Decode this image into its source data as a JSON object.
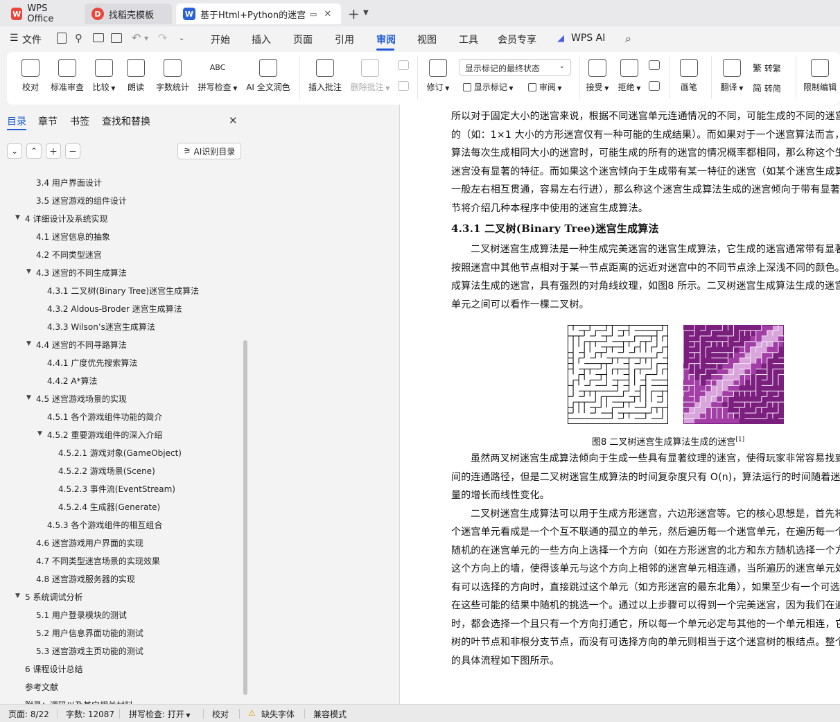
{
  "tabs": [
    {
      "label": "WPS Office",
      "icon": "wps-logo-icon",
      "color": "#e8473c"
    },
    {
      "label": "找稻壳模板",
      "icon": "docer-icon",
      "color": "#e8473c"
    },
    {
      "label": "基于Html+Python的迷宫游戏",
      "icon": "word-doc-icon",
      "color": "#2b62d9"
    }
  ],
  "menu": {
    "file": "文件",
    "items": [
      "开始",
      "插入",
      "页面",
      "引用",
      "审阅",
      "视图",
      "工具",
      "会员专享"
    ],
    "wps_ai": "WPS AI"
  },
  "ribbon": {
    "proofread": "校对",
    "standard_review": "标准审查",
    "compare": "比较",
    "read_aloud": "朗读",
    "word_count": "字数统计",
    "spell_check": "拼写检查",
    "ai_polish": "AI 全文润色",
    "insert_comment": "插入批注",
    "delete_comment": "删除批注",
    "markup_state": "显示标记的最终状态",
    "track_changes": "修订",
    "show_markup": "显示标记",
    "review_pane": "审阅",
    "accept": "接受",
    "reject": "拒绝",
    "ink": "画笔",
    "translate": "翻译",
    "to_traditional": "转繁",
    "to_simplified": "转简",
    "restrict_edit": "限制编辑"
  },
  "left_pane": {
    "tabs": [
      "目录",
      "章节",
      "书签",
      "查找和替换"
    ],
    "ai_toc": "AI识别目录",
    "toc": [
      {
        "label": "3.4  用户界面设计",
        "level": 2,
        "arrow": false
      },
      {
        "label": "3.5  迷宫游戏的组件设计",
        "level": 2,
        "arrow": false
      },
      {
        "label": "4  详细设计及系统实现",
        "level": 1,
        "arrow": true
      },
      {
        "label": "4.1  迷宫信息的抽象",
        "level": 2,
        "arrow": false
      },
      {
        "label": "4.2  不同类型迷宫",
        "level": 2,
        "arrow": false
      },
      {
        "label": "4.3  迷宫的不同生成算法",
        "level": 2,
        "arrow": true
      },
      {
        "label": "4.3.1 二叉树(Binary Tree)迷宫生成算法",
        "level": 3,
        "arrow": false
      },
      {
        "label": "4.3.2 Aldous-Broder 迷宫生成算法",
        "level": 3,
        "arrow": false
      },
      {
        "label": "4.3.3 Wilson’s迷宫生成算法",
        "level": 3,
        "arrow": false
      },
      {
        "label": "4.4  迷宫的不同寻路算法",
        "level": 2,
        "arrow": true
      },
      {
        "label": "4.4.1 广度优先搜索算法",
        "level": 3,
        "arrow": false
      },
      {
        "label": "4.4.2 A*算法",
        "level": 3,
        "arrow": false
      },
      {
        "label": "4.5  迷宫游戏场景的实现",
        "level": 2,
        "arrow": true
      },
      {
        "label": "4.5.1  各个游戏组件功能的简介",
        "level": 3,
        "arrow": false
      },
      {
        "label": "4.5.2  重要游戏组件的深入介绍",
        "level": 3,
        "arrow": true
      },
      {
        "label": "4.5.2.1  游戏对象(GameObject)",
        "level": 4,
        "arrow": false
      },
      {
        "label": "4.5.2.2  游戏场景(Scene)",
        "level": 4,
        "arrow": false
      },
      {
        "label": "4.5.2.3  事件流(EventStream)",
        "level": 4,
        "arrow": false
      },
      {
        "label": "4.5.2.4  生成器(Generate)",
        "level": 4,
        "arrow": false
      },
      {
        "label": "4.5.3  各个游戏组件的相互组合",
        "level": 3,
        "arrow": false
      },
      {
        "label": "4.6  迷宫游戏用户界面的实现",
        "level": 2,
        "arrow": false
      },
      {
        "label": "4.7  不同类型迷宫场景的实现效果",
        "level": 2,
        "arrow": false
      },
      {
        "label": "4.8  迷宫游戏服务器的实现",
        "level": 2,
        "arrow": false
      },
      {
        "label": "5  系统调试分析",
        "level": 1,
        "arrow": true
      },
      {
        "label": "5.1  用户登录模块的测试",
        "level": 2,
        "arrow": false
      },
      {
        "label": "5.2  用户信息界面功能的测试",
        "level": 2,
        "arrow": false
      },
      {
        "label": "5.3  迷宫游戏主页功能的测试",
        "level": 2,
        "arrow": false
      },
      {
        "label": "6  课程设计总结",
        "level": 1,
        "arrow": false
      },
      {
        "label": "参考文献",
        "level": 1,
        "arrow": false
      },
      {
        "label": "附录：源码以及其它相关材料",
        "level": 1,
        "arrow": false
      }
    ]
  },
  "document": {
    "lines_top": [
      "所以对于固定大小的迷宫来说，根据不同迷宫单元连通情况的不同，可能生成的不同的迷宫的",
      "的（如：1×1 大小的方形迷宫仅有一种可能的生成结果）。而如果对于一个迷宫算法而言，若",
      "算法每次生成相同大小的迷宫时，可能生成的所有的迷宫的情况概率都相同，那么称这个生成",
      "迷宫没有显著的特征。而如果这个迷宫倾向于生成带有某一特征的迷宫（如某个迷宫生成算法",
      "一般左右相互贯通，容易左右行进），那么称这个迷宫生成算法生成的迷宫倾向于带有显著的",
      "节将介绍几种本程序中使用的迷宫生成算法。"
    ],
    "heading": "4.3.1 二叉树(Binary Tree)迷宫生成算法",
    "lines_mid": [
      "二叉树迷宫生成算法是一种生成完美迷宫的迷宫生成算法，它生成的迷宫通常带有显著",
      "按照迷宫中其他节点相对于某一节点距离的远近对迷宫中的不同节点涂上深浅不同的颜色。采",
      "成算法生成的迷宫，具有强烈的对角线纹理，如图8 所示。二叉树迷宫生成算法生成的迷宫中",
      "单元之间可以看作一棵二叉树。"
    ],
    "caption": "图8  二叉树迷宫生成算法生成的迷宫",
    "caption_ref": "[1]",
    "lines_bottom": [
      "虽然两叉树迷宫生成算法倾向于生成一些具有显著纹理的迷宫，使得玩家非常容易找到起",
      "间的连通路径，但是二叉树迷宫生成算法的时间复杂度只有 O(n)，算法运行的时间随着迷宫单",
      "量的增长而线性变化。",
      "二叉树迷宫生成算法可以用于生成方形迷宫，六边形迷宫等。它的核心思想是，首先将迷",
      "个迷宫单元看成是一个个互不联通的孤立的单元，然后遍历每一个迷宫单元，在遍历每一个单",
      "随机的在迷宫单元的一些方向上选择一个方向（如在方形迷宫的北方和东方随机选择一个方向",
      "这个方向上的墙，使得该单元与这个方向上相邻的迷宫单元相连通，当所遍历的迷宫单元处于",
      "有可以选择的方向时，直接跳过这个单元（如方形迷宫的最东北角），如果至少有一个可选择",
      "在这些可能的结果中随机的挑选一个。通过以上步骤可以得到一个完美迷宫，因为我们在遍历",
      "时，都会选择一个且只有一个方向打通它，所以每一个单元必定与其他的一个单元相连，它们",
      "树的叶节点和非根分支节点，而没有可选择方向的单元则相当于这个迷宫树的根结点。整个算",
      "的具体流程如下图所示。"
    ]
  },
  "status": {
    "page": "页面: 8/22",
    "words": "字数: 12087",
    "spell": "拼写检查: 打开",
    "proof": "校对",
    "missing_font": "缺失字体",
    "compat": "兼容模式"
  },
  "colors": {
    "accent": "#1e5bd8",
    "maze_purple_dark": "#7b1f7e",
    "maze_purple_mid": "#a23fa6",
    "maze_purple_light": "#d9a6dc"
  }
}
